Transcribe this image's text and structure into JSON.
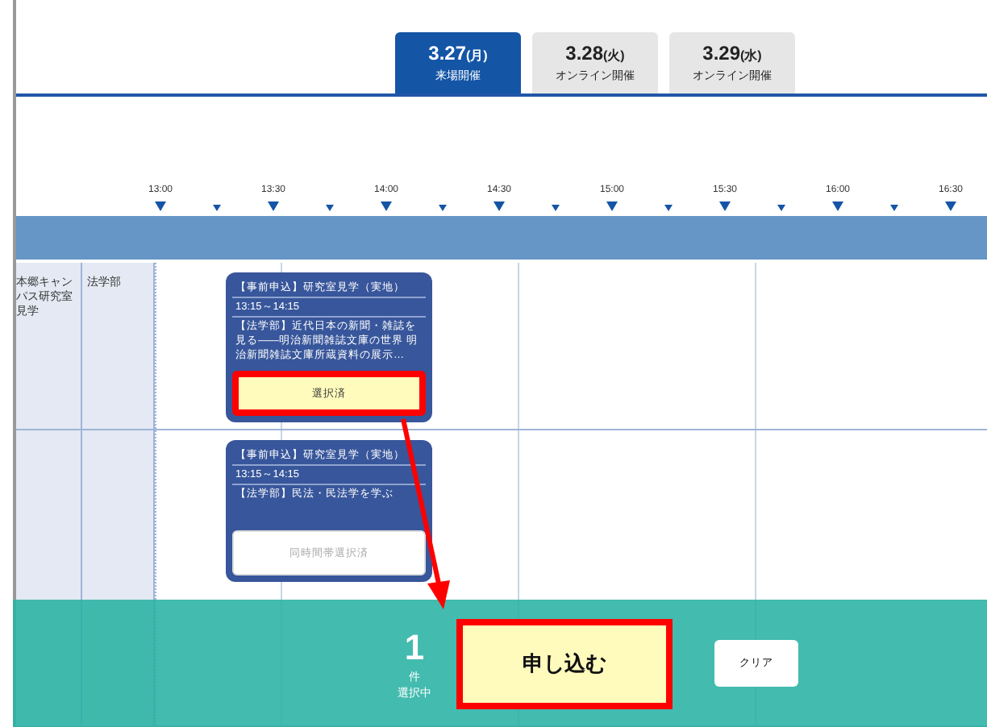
{
  "date_tabs": [
    {
      "date": "3.27",
      "weekday": "(月)",
      "mode": "来場開催",
      "selected": true
    },
    {
      "date": "3.28",
      "weekday": "(火)",
      "mode": "オンライン開催",
      "selected": false
    },
    {
      "date": "3.29",
      "weekday": "(水)",
      "mode": "オンライン開催",
      "selected": false
    }
  ],
  "timeline": {
    "ticks": [
      "13:00",
      "13:30",
      "14:00",
      "14:30",
      "15:00",
      "15:30",
      "16:00",
      "16:30"
    ]
  },
  "rows": [
    {
      "campus": "本郷キャンパス研究室見学",
      "faculty": "法学部",
      "event": {
        "title": "【事前申込】研究室見学（実地）",
        "time": "13:15～14:15",
        "description": "【法学部】近代日本の新聞・雑誌を見る——明治新聞雑誌文庫の世界 明治新聞雑誌文庫所蔵資料の展示…",
        "action": "選択済",
        "kind": "selected",
        "highlighted": true
      }
    },
    {
      "event": {
        "title": "【事前申込】研究室見学（実地）",
        "time": "13:15～14:15",
        "description": "【法学部】民法・民法学を学ぶ",
        "action": "同時間帯選択済",
        "kind": "conflict",
        "highlighted": false
      }
    }
  ],
  "selection_bar": {
    "count": "1",
    "unit": "件",
    "label": "選択中",
    "apply": "申し込む",
    "apply_highlighted": true,
    "clear": "クリア"
  }
}
